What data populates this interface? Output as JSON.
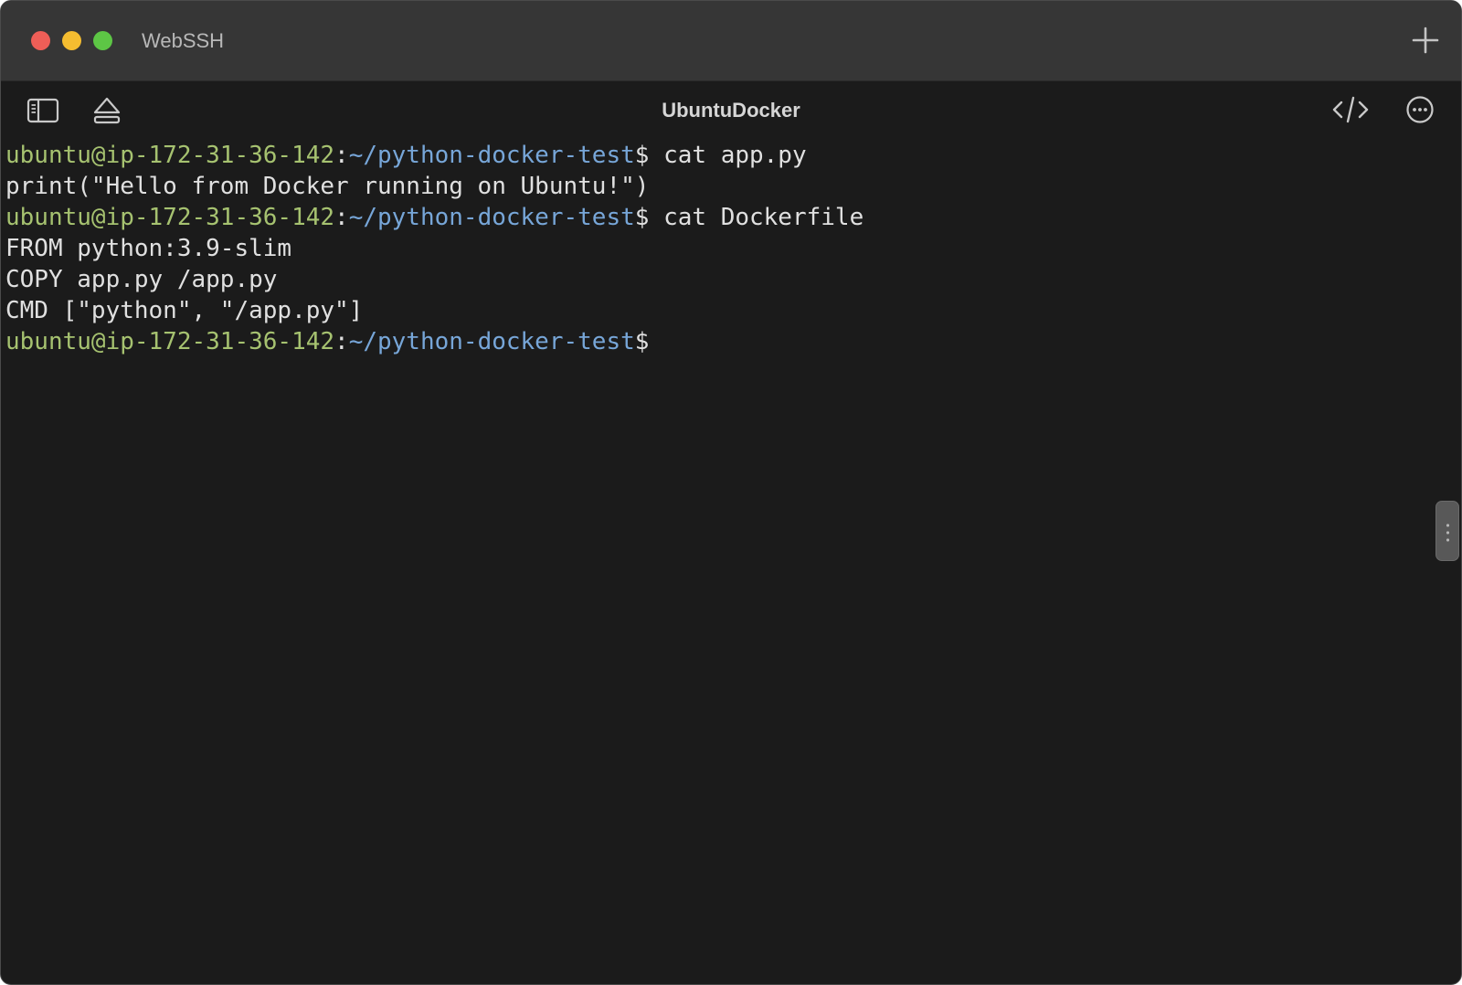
{
  "window": {
    "app_title": "WebSSH",
    "controls": [
      "close",
      "minimize",
      "zoom"
    ],
    "new_tab_icon": "plus-icon"
  },
  "toolbar": {
    "session_title": "UbuntuDocker",
    "left_icons": [
      "sidebar-toggle-icon",
      "eject-icon"
    ],
    "right_icons": [
      "code-icon",
      "more-icon"
    ]
  },
  "terminal": {
    "colors": {
      "background": "#1b1b1b",
      "text": "#e0e0e0",
      "user_host": "#a6c270",
      "path": "#77a6d8"
    },
    "lines": [
      {
        "type": "prompt",
        "user_host": "ubuntu@ip-172-31-36-142",
        "sep": ":",
        "path": "~/python-docker-test",
        "symbol": "$",
        "command": " cat app.py"
      },
      {
        "type": "output",
        "text": "print(\"Hello from Docker running on Ubuntu!\")"
      },
      {
        "type": "prompt",
        "user_host": "ubuntu@ip-172-31-36-142",
        "sep": ":",
        "path": "~/python-docker-test",
        "symbol": "$",
        "command": " cat Dockerfile"
      },
      {
        "type": "output",
        "text": "FROM python:3.9-slim"
      },
      {
        "type": "output",
        "text": "COPY app.py /app.py"
      },
      {
        "type": "output",
        "text": "CMD [\"python\", \"/app.py\"]"
      },
      {
        "type": "prompt",
        "user_host": "ubuntu@ip-172-31-36-142",
        "sep": ":",
        "path": "~/python-docker-test",
        "symbol": "$",
        "command": ""
      }
    ]
  },
  "scroll_handle_icon": "drag-handle-icon"
}
